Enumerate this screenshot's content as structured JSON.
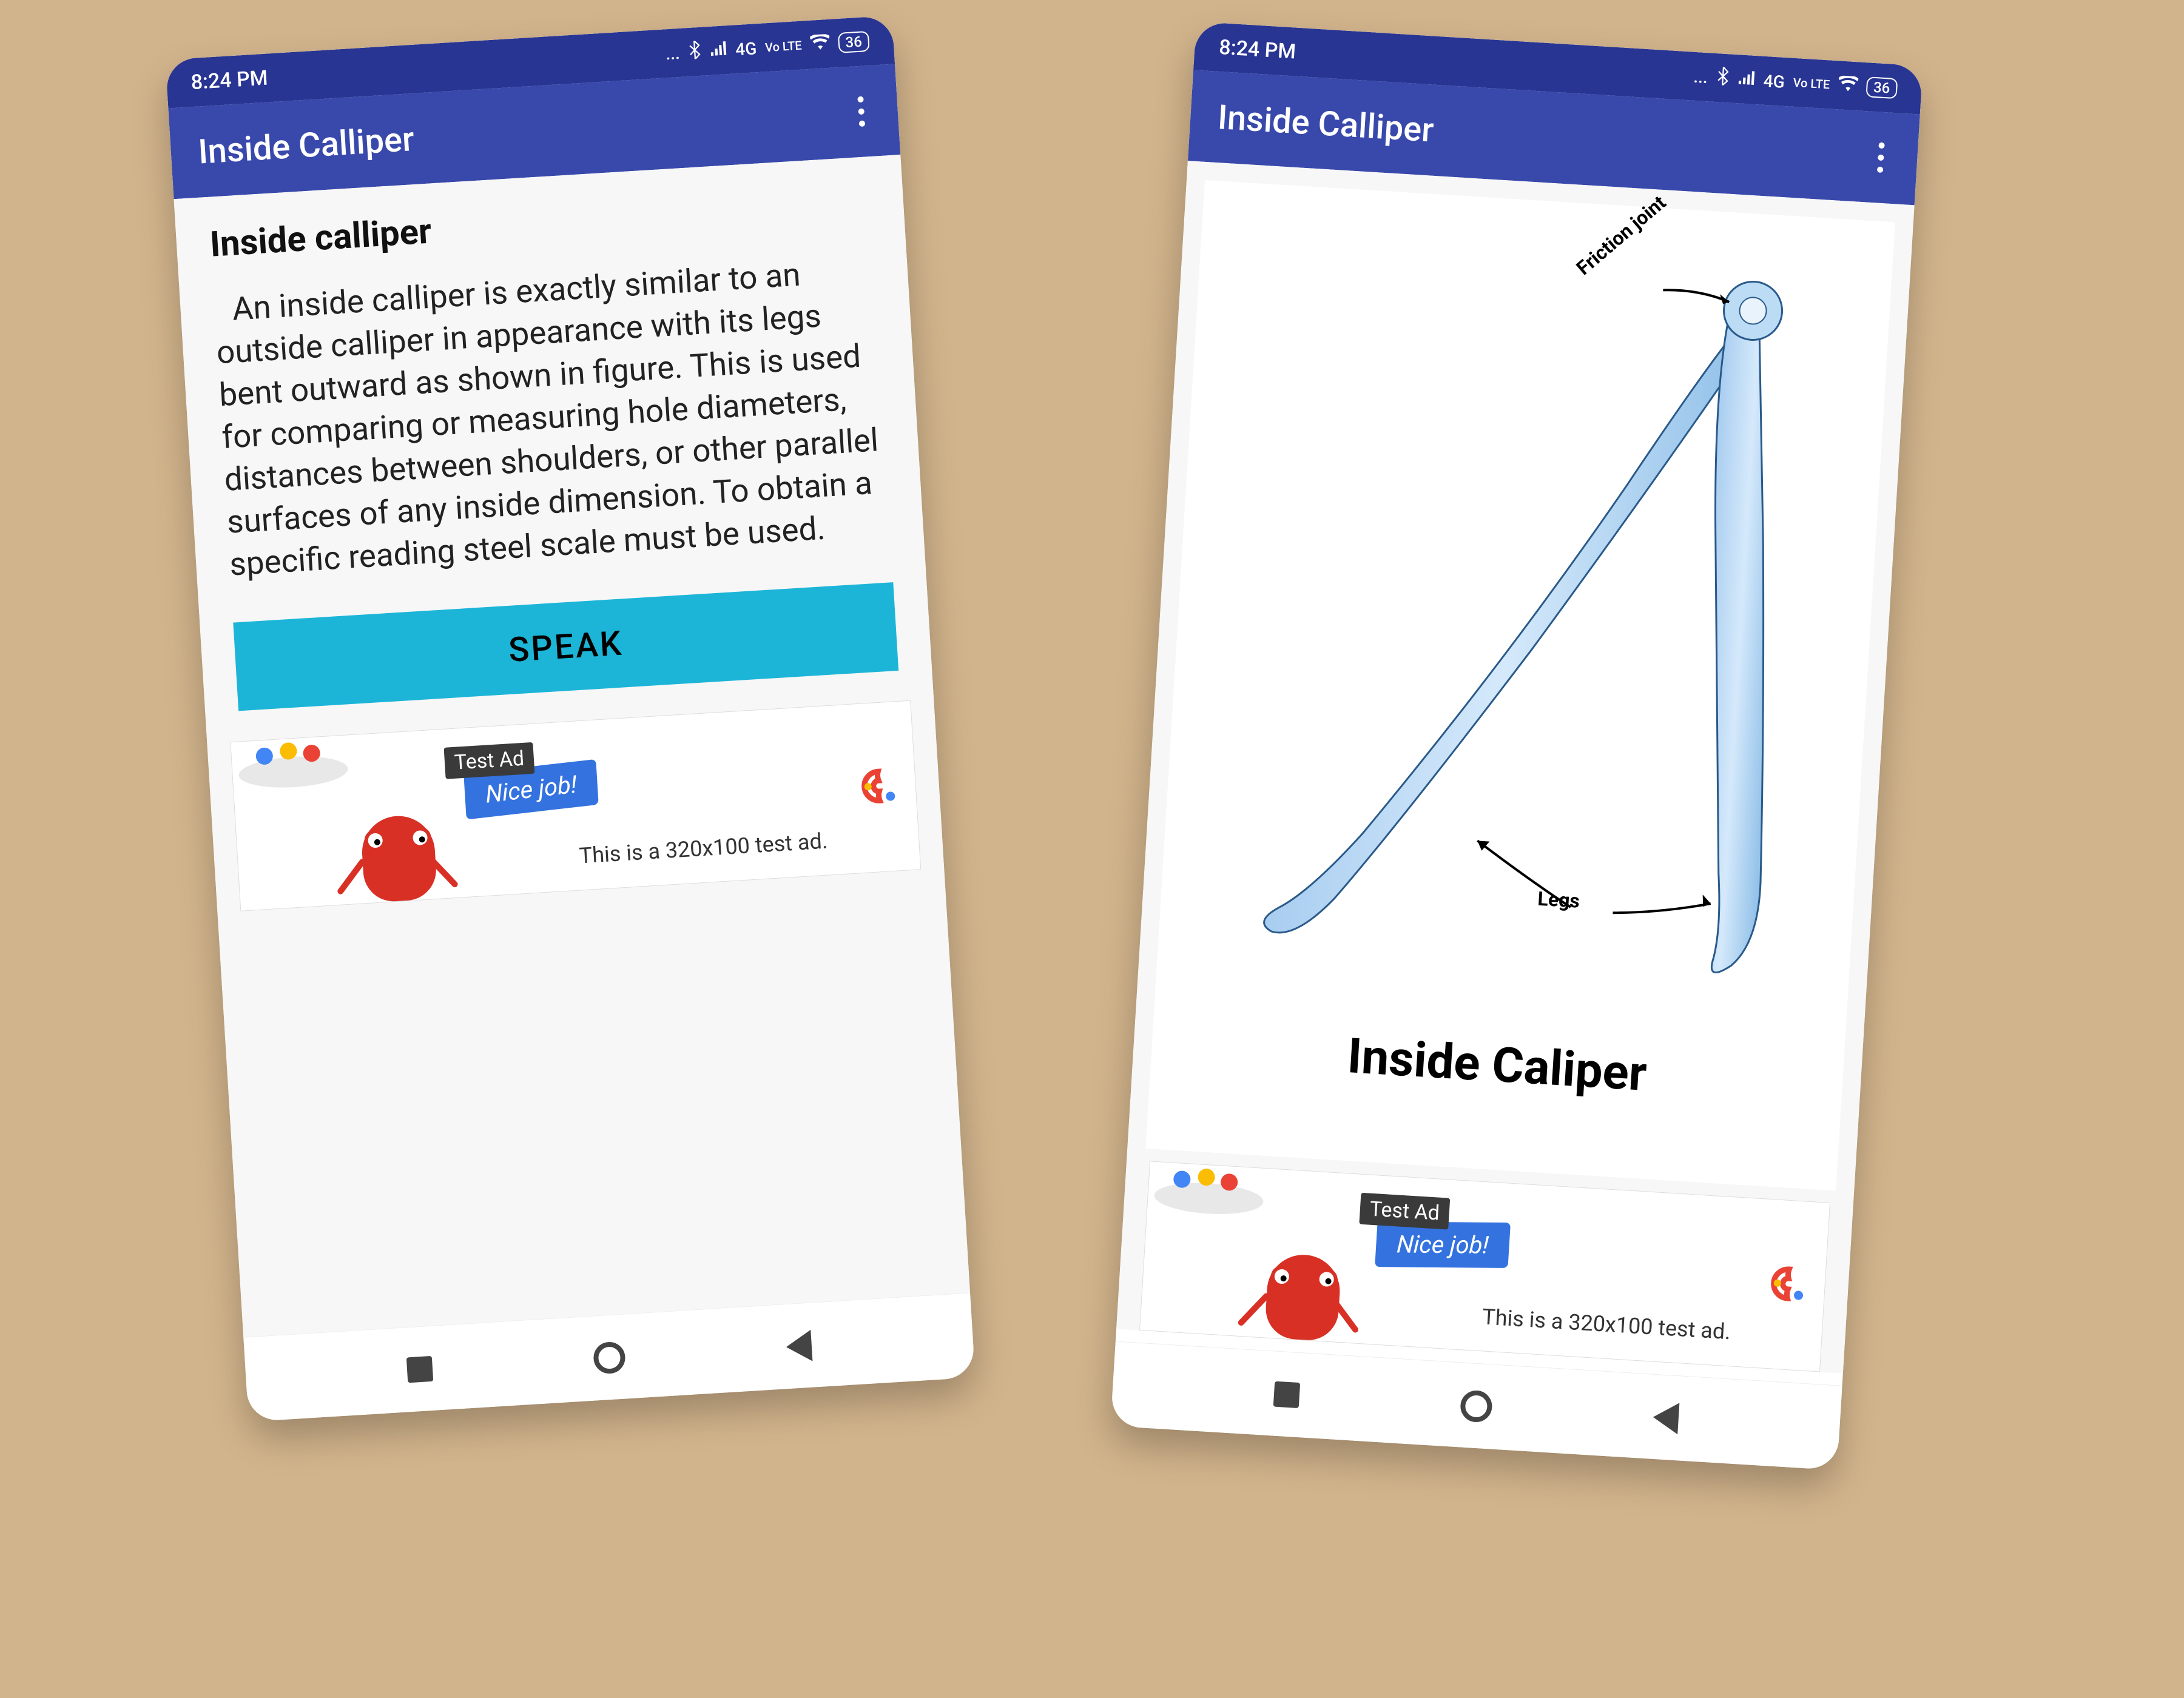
{
  "status": {
    "time": "8:24 PM",
    "network": "4G",
    "volte": "Vo LTE",
    "battery": "36",
    "dots": "..."
  },
  "appbar": {
    "title": "Inside Calliper"
  },
  "screen1": {
    "heading": "Inside calliper",
    "body": "An inside calliper is exactly similar to an outside calliper in appearance with its legs bent outward as shown in figure. This is used for comparing or measuring hole diameters, distances between shoulders, or other parallel surfaces of any inside dimension. To obtain a specific reading steel scale must be used.",
    "speak_label": "SPEAK"
  },
  "screen2": {
    "caption": "Inside Caliper",
    "label_joint": "Friction joint",
    "label_legs": "Legs"
  },
  "ad": {
    "tag": "Test Ad",
    "bubble": "Nice job!",
    "text": "This is a 320x100 test ad."
  }
}
